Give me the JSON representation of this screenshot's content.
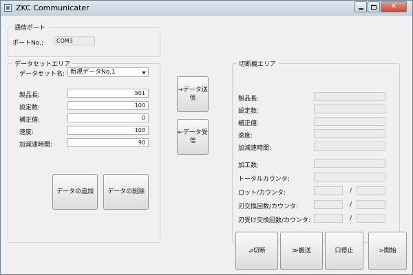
{
  "window": {
    "title": "ZKC Communicater"
  },
  "comm": {
    "legend": "通信ポート",
    "port_label": "ポートNo.:",
    "port_value": "COM3"
  },
  "dataset": {
    "legend": "データセットエリア",
    "name_label": "データセット名:",
    "name_value": "新規データNo.1",
    "fields": [
      {
        "label": "製品長:",
        "value": "501"
      },
      {
        "label": "設定数:",
        "value": "100"
      },
      {
        "label": "補正値:",
        "value": "0"
      },
      {
        "label": "速度:",
        "value": "100"
      },
      {
        "label": "加減速時間:",
        "value": "90"
      }
    ],
    "add_button": "データの追加",
    "delete_button": "データの削除"
  },
  "transfer": {
    "send_button": "→データ送\n信",
    "receive_button": "←データ受\n信"
  },
  "cutter": {
    "legend": "切断機エリア",
    "fields": [
      {
        "label": "製品長:"
      },
      {
        "label": "設定数:"
      },
      {
        "label": "補正値:"
      },
      {
        "label": "速度:"
      },
      {
        "label": "加減速時間:"
      },
      {
        "label": "加工数:"
      },
      {
        "label": "トータルカウンタ:"
      }
    ],
    "pair_fields": [
      {
        "label": "ロット/カウンタ:",
        "separator": "/"
      },
      {
        "label": "刃交換回数/カウンタ:",
        "separator": "/"
      },
      {
        "label": "刃受け交換回数/カウンタ:",
        "separator": "/"
      }
    ]
  },
  "actions": {
    "cut": "⊿切断",
    "feed": "≫搬送",
    "stop": "口停止",
    "start": ">開始"
  }
}
